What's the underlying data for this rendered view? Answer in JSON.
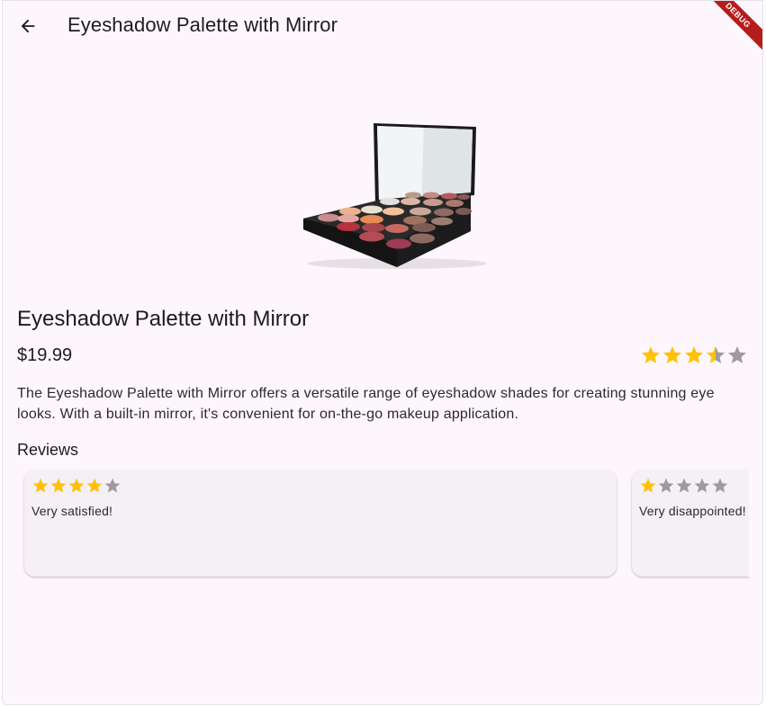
{
  "appbar": {
    "title": "Eyeshadow Palette with Mirror",
    "back_icon": "arrow-left-icon",
    "debug_label": "DEBUG"
  },
  "product": {
    "name": "Eyeshadow Palette with Mirror",
    "price": "$19.99",
    "rating": 3.5,
    "rating_max": 5,
    "description": "The Eyeshadow Palette with Mirror offers a versatile range of eyeshadow shades for creating stunning eye looks. With a built-in mirror, it's convenient for on-the-go makeup application."
  },
  "reviews": {
    "heading": "Reviews",
    "items": [
      {
        "rating": 4,
        "text": "Very satisfied!"
      },
      {
        "rating": 1,
        "text": "Very disappointed!"
      }
    ]
  },
  "colors": {
    "star_filled": "#ffc107",
    "star_empty": "#9e9a9f",
    "background": "#fdf7fd",
    "card": "#f5eff6",
    "debug_banner": "#b71c1c"
  }
}
